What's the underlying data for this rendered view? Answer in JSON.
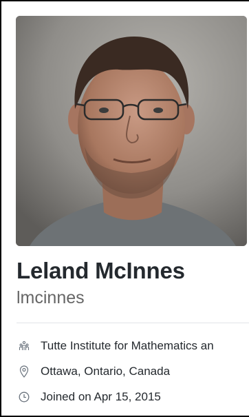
{
  "profile": {
    "full_name": "Leland McInnes",
    "username": "lmcinnes",
    "avatar_icon": "profile-photo",
    "details": [
      {
        "icon": "organization-icon",
        "text": "Tutte Institute for Mathematics an"
      },
      {
        "icon": "location-icon",
        "text": "Ottawa, Ontario, Canada"
      },
      {
        "icon": "clock-icon",
        "text": "Joined on Apr 15, 2015"
      }
    ]
  },
  "colors": {
    "name": "#24292e",
    "username": "#666666",
    "icon": "#6a737d",
    "divider": "#e1e4e8"
  }
}
